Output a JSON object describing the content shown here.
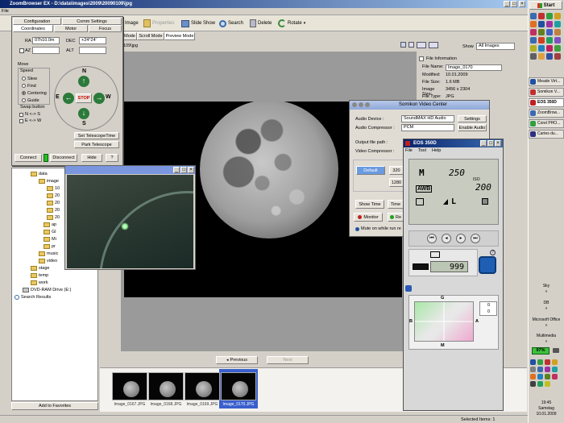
{
  "app": {
    "title": "ZoomBrowser EX  -  D:\\data\\images\\2009\\20090109\\jpg",
    "menu_first": "File"
  },
  "toolbar": {
    "image_label": "Image",
    "properties_label": "Properties",
    "slideshow_label": "Slide Show",
    "search_label": "Search",
    "delete_label": "Delete",
    "rotate_label": "Rotate"
  },
  "view_tabs": {
    "mode_suffix": "Mode",
    "scroll": "Scroll Mode",
    "preview": "Preview Mode",
    "path_suffix": "109\\jpg"
  },
  "show": {
    "label": "Show",
    "value": "All Images"
  },
  "file_info": {
    "heading": "File Information",
    "rows": [
      {
        "label": "File Name:",
        "value": "Image_0170"
      },
      {
        "label": "Modified:",
        "value": "10.01.2009"
      },
      {
        "label": "File Size:",
        "value": "1.6 MB"
      },
      {
        "label": "Image Size:",
        "value": "3456 x 2304"
      },
      {
        "label": "File Type:",
        "value": "JPG"
      }
    ]
  },
  "telescope": {
    "tabs_top": [
      "Configuration",
      "Comm Settings"
    ],
    "tabs_bottom": [
      "Coordinates",
      "Motor",
      "Focus"
    ],
    "ra_label": "RA",
    "ra_value": "07h10.0m",
    "dec_label": "DEC",
    "dec_value": "+24°24'",
    "az_label": "AZ",
    "alt_label": "ALT",
    "move_label": "Move",
    "speed_label": "Speed",
    "speeds": [
      "Slew",
      "Find",
      "Centering",
      "Guide"
    ],
    "swap_label": "Swap button",
    "swap_options": [
      "N <-> S",
      "E <-> W"
    ],
    "n": "N",
    "s": "S",
    "e": "E",
    "w": "W",
    "stop": "STOP",
    "set_time": "Set TelescopeTime",
    "park": "Park Telescope",
    "connect": "Connect",
    "disconnect": "Disconnect",
    "hide": "Hide",
    "help": "?"
  },
  "tree": {
    "items": [
      {
        "label": "data",
        "indent": 1
      },
      {
        "label": "image",
        "indent": 2
      },
      {
        "label": "10",
        "indent": 3
      },
      {
        "label": "20",
        "indent": 3
      },
      {
        "label": "20",
        "indent": 3
      },
      {
        "label": "20",
        "indent": 3
      },
      {
        "label": "20",
        "indent": 3
      },
      {
        "label": "ap",
        "indent": 2
      },
      {
        "label": "Gl",
        "indent": 2
      },
      {
        "label": "Mi",
        "indent": 2
      },
      {
        "label": "pr",
        "indent": 2
      },
      {
        "label": "music",
        "indent": 2
      },
      {
        "label": "video",
        "indent": 2
      },
      {
        "label": "stage",
        "indent": 1
      },
      {
        "label": "temp",
        "indent": 1
      },
      {
        "label": "work",
        "indent": 1
      },
      {
        "label": "DVD-RAM Drive (E:)",
        "indent": 0
      },
      {
        "label": "Search Results",
        "indent": -1
      }
    ],
    "add_favorites": "Add to Favorites"
  },
  "navigation": {
    "previous": "Previous",
    "next": "Next"
  },
  "thumbnails": [
    {
      "label": "Image_0167.JPG"
    },
    {
      "label": "Image_0168.JPG"
    },
    {
      "label": "Image_0169.JPG"
    },
    {
      "label": "Image_0170.JPG",
      "selected": true
    }
  ],
  "statusbar": {
    "selected": "Selected Items: 1"
  },
  "video_center": {
    "title": "Somikon Video Center",
    "audio_device_label": "Audio Device :",
    "audio_device_value": "SoundMAX HD Audio",
    "audio_compressor_label": "Audio Compressor :",
    "audio_compressor_value": "PCM",
    "settings": "Settings",
    "enable_audio": "Enable Audio",
    "output_label": "Output file path :",
    "video_compressor_label": "Video Compressor :",
    "default_btn": "Default",
    "res1": "320",
    "res2": "1280",
    "show_time": "Show Time",
    "time": "Time",
    "monitor": "Monitor",
    "record": "Re",
    "mute": "Mute on while run re"
  },
  "eos": {
    "title": "EOS 350D",
    "menu": [
      "File",
      "Tool",
      "Help"
    ],
    "mode": "M",
    "shutter": "250",
    "iso_label": "ISO",
    "iso": "200",
    "awb": "AWB",
    "quality": "L",
    "shots": "999",
    "wb_g": "G",
    "wb_b": "B",
    "wb_a": "A",
    "wb_m": "M",
    "wb_val1": "0",
    "wb_val2": "0"
  },
  "taskbar": {
    "start": "Start",
    "tasks": [
      "Meade Virt...",
      "Somikon V...",
      "EOS 350D",
      "ZoomBrow...",
      "Corel PHO...",
      "Cartes du..."
    ],
    "sky": "Sky",
    "db": "DB",
    "office": "Microsoft Office",
    "multimedia": "Multimedia",
    "battery": "97%",
    "clock_time": "19:45",
    "clock_day": "Samstag",
    "clock_date": "10.01.2009"
  },
  "colors": {
    "titlebar_active": "#0a246a",
    "titlebar_inactive": "#7a96df",
    "viewer_bg": "#9a9a9a",
    "selected_thumb": "#3a5fcd"
  }
}
